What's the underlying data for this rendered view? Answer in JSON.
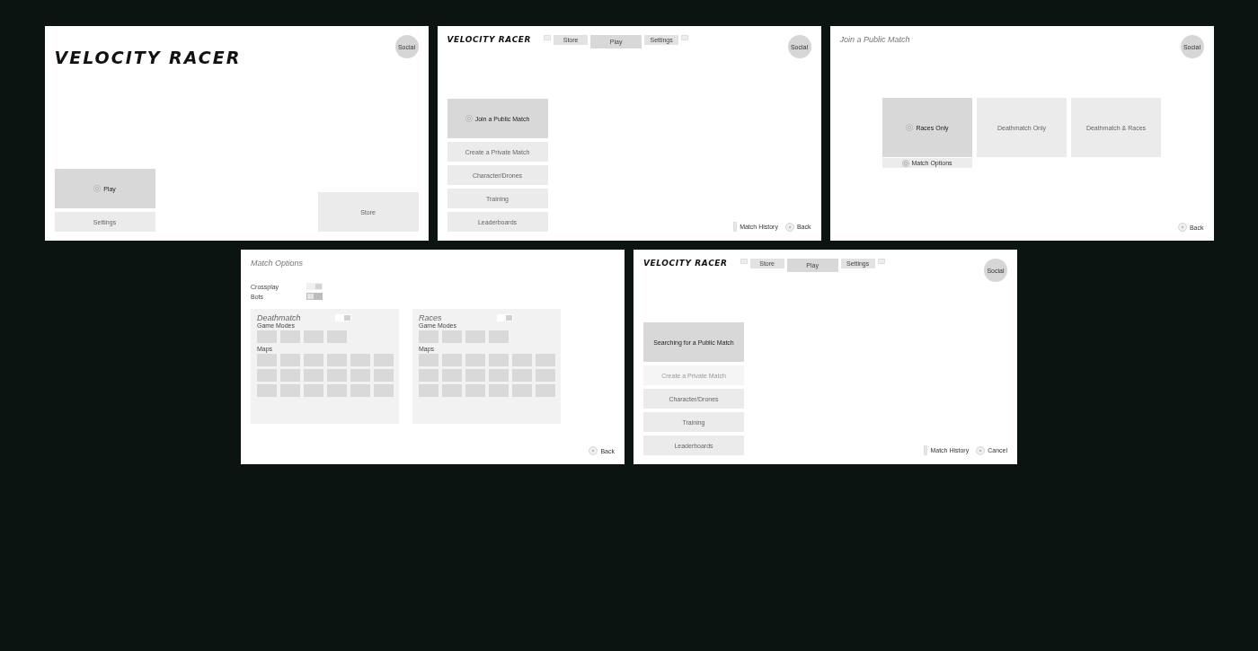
{
  "frames": [
    {
      "kind": "title",
      "logo": "VELOCITY RACER",
      "social": "Social",
      "buttons": [
        {
          "label": "Play",
          "selected": true
        },
        {
          "label": "Settings",
          "selected": false
        }
      ],
      "store": "Store"
    },
    {
      "kind": "menu",
      "logo": "VELOCITY RACER",
      "social": "Social",
      "tabs": [
        {
          "label": "Store",
          "selected": false
        },
        {
          "label": "Play",
          "selected": true
        },
        {
          "label": "Settings",
          "selected": false
        }
      ],
      "menu": [
        {
          "label": "Join a Public Match",
          "selected": true,
          "disabled": false,
          "icon": true
        },
        {
          "label": "Create a Private Match",
          "selected": false,
          "disabled": false,
          "icon": false
        },
        {
          "label": "Character/Drones",
          "selected": false,
          "disabled": false,
          "icon": false
        },
        {
          "label": "Training",
          "selected": false,
          "disabled": false,
          "icon": false
        },
        {
          "label": "Leaderboards",
          "selected": false,
          "disabled": false,
          "icon": false
        }
      ],
      "footer": [
        {
          "kind": "history",
          "label": "Match History"
        },
        {
          "kind": "back",
          "label": "Back"
        }
      ]
    },
    {
      "kind": "modes",
      "heading": "Join a Public Match",
      "social": "Social",
      "modes": [
        {
          "label": "Races Only",
          "selected": true
        },
        {
          "label": "Deathmatch Only",
          "selected": false
        },
        {
          "label": "Deathmatch & Races",
          "selected": false
        }
      ],
      "options_label": "Match Options",
      "footer": [
        {
          "kind": "back",
          "label": "Back"
        }
      ]
    },
    {
      "kind": "options",
      "heading": "Match Options",
      "toggles": [
        {
          "label": "Crossplay",
          "on": true
        },
        {
          "label": "Bots",
          "on": false
        }
      ],
      "sections": [
        {
          "title": "Deathmatch",
          "on": true,
          "modes_label": "Game Modes",
          "maps_label": "Maps"
        },
        {
          "title": "Races",
          "on": true,
          "modes_label": "Game Modes",
          "maps_label": "Maps"
        }
      ],
      "footer": [
        {
          "kind": "back",
          "label": "Back"
        }
      ]
    },
    {
      "kind": "menu",
      "logo": "VELOCITY RACER",
      "social": "Social",
      "tabs": [
        {
          "label": "Store",
          "selected": false
        },
        {
          "label": "Play",
          "selected": true
        },
        {
          "label": "Settings",
          "selected": false
        }
      ],
      "menu": [
        {
          "label": "Searching for a Public Match",
          "selected": true,
          "disabled": false,
          "icon": false
        },
        {
          "label": "Create a Private Match",
          "selected": false,
          "disabled": true,
          "icon": false
        },
        {
          "label": "Character/Drones",
          "selected": false,
          "disabled": false,
          "icon": false
        },
        {
          "label": "Training",
          "selected": false,
          "disabled": false,
          "icon": false
        },
        {
          "label": "Leaderboards",
          "selected": false,
          "disabled": false,
          "icon": false
        }
      ],
      "footer": [
        {
          "kind": "history",
          "label": "Match History"
        },
        {
          "kind": "back",
          "label": "Cancel"
        }
      ]
    }
  ]
}
